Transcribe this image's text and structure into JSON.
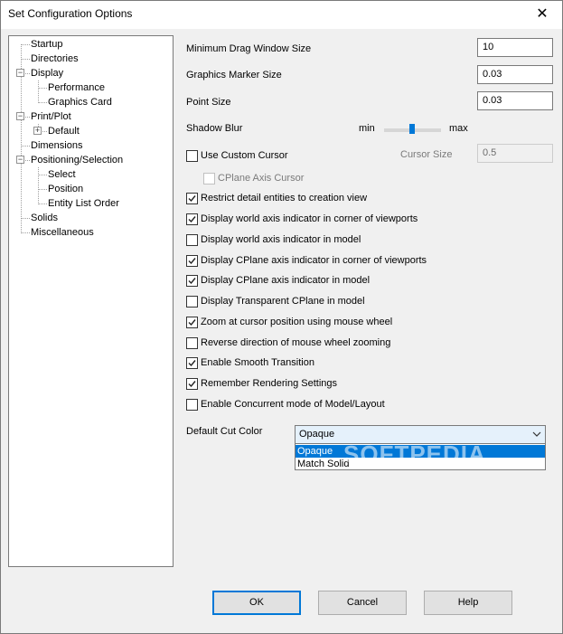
{
  "window": {
    "title": "Set Configuration Options",
    "close_glyph": "✕"
  },
  "tree": {
    "items": [
      {
        "label": "Startup",
        "level": 0
      },
      {
        "label": "Directories",
        "level": 0
      },
      {
        "label": "Display",
        "level": 0,
        "expander": "−"
      },
      {
        "label": "Performance",
        "level": 1
      },
      {
        "label": "Graphics Card",
        "level": 1
      },
      {
        "label": "Print/Plot",
        "level": 0,
        "expander": "−"
      },
      {
        "label": "Default",
        "level": 1,
        "expander": "+"
      },
      {
        "label": "Dimensions",
        "level": 0
      },
      {
        "label": "Positioning/Selection",
        "level": 0,
        "expander": "−"
      },
      {
        "label": "Select",
        "level": 1
      },
      {
        "label": "Position",
        "level": 1
      },
      {
        "label": "Entity List Order",
        "level": 1
      },
      {
        "label": "Solids",
        "level": 0
      },
      {
        "label": "Miscellaneous",
        "level": 0
      }
    ]
  },
  "fields": {
    "min_drag_label": "Minimum Drag Window Size",
    "min_drag_value": "10",
    "marker_size_label": "Graphics Marker Size",
    "marker_size_value": "0.03",
    "point_size_label": "Point Size",
    "point_size_value": "0.03",
    "shadow_blur_label": "Shadow Blur",
    "shadow_min": "min",
    "shadow_max": "max",
    "cursor_size_label": "Cursor Size",
    "cursor_size_value": "0.5"
  },
  "checkboxes": [
    {
      "label": "Use Custom Cursor",
      "checked": false
    },
    {
      "label": "CPlane Axis Cursor",
      "checked": false,
      "disabled": true
    },
    {
      "label": "Restrict detail entities to creation view",
      "checked": true
    },
    {
      "label": "Display world axis indicator in corner of viewports",
      "checked": true
    },
    {
      "label": "Display world axis indicator in model",
      "checked": false
    },
    {
      "label": "Display CPlane axis indicator in corner of viewports",
      "checked": true
    },
    {
      "label": "Display CPlane axis indicator in model",
      "checked": true
    },
    {
      "label": "Display Transparent CPlane in model",
      "checked": false
    },
    {
      "label": "Zoom at cursor position using mouse wheel",
      "checked": true
    },
    {
      "label": "Reverse direction of mouse wheel zooming",
      "checked": false
    },
    {
      "label": "Enable Smooth Transition",
      "checked": true
    },
    {
      "label": "Remember Rendering Settings",
      "checked": true
    },
    {
      "label": "Enable Concurrent mode of Model/Layout",
      "checked": false
    }
  ],
  "cut_color": {
    "label": "Default Cut Color",
    "selected": "Opaque",
    "options": [
      "Opaque",
      "Match Solid"
    ]
  },
  "watermark": "SOFTPEDIA",
  "buttons": {
    "ok": "OK",
    "cancel": "Cancel",
    "help": "Help"
  },
  "colors": {
    "accent": "#0078d7",
    "window_bg": "#f0f0f0"
  }
}
